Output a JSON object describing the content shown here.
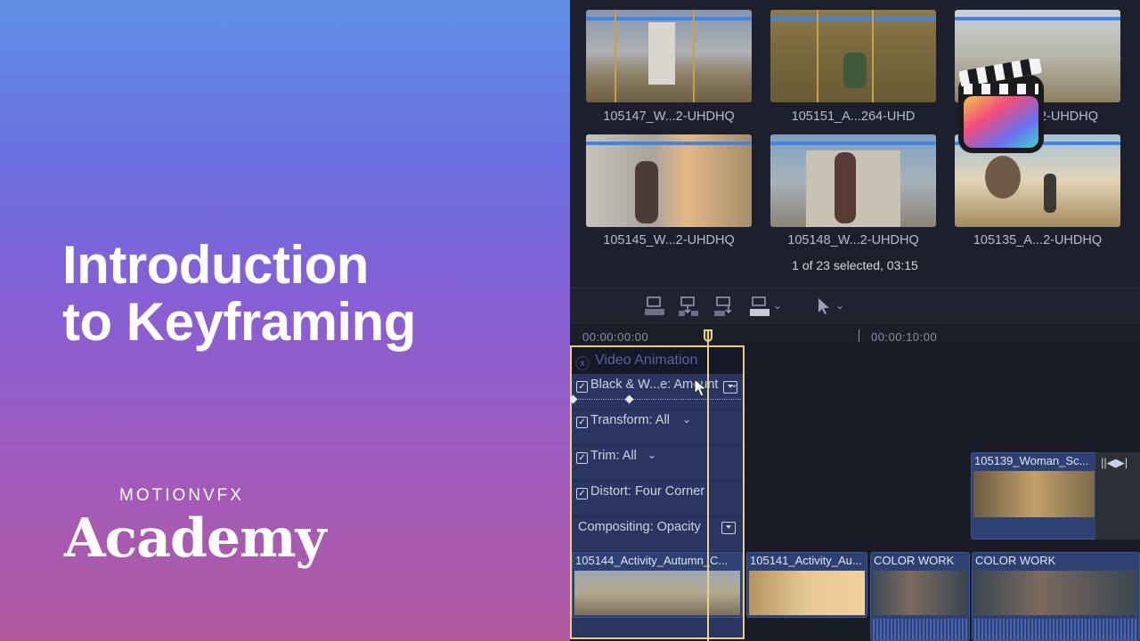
{
  "promo": {
    "title_line1": "Introduction",
    "title_line2": "to Keyframing",
    "brand_top": "MOTIONVFX",
    "brand_main": "Academy"
  },
  "browser": {
    "clips": [
      {
        "label": "105147_W...2-UHDHQ"
      },
      {
        "label": "105151_A...264-UHD"
      },
      {
        "label": "2-UHDHQ"
      },
      {
        "label": "105145_W...2-UHDHQ"
      },
      {
        "label": "105148_W...2-UHDHQ"
      },
      {
        "label": "105135_A...2-UHDHQ"
      }
    ],
    "status": "1 of 23 selected, 03:15"
  },
  "ruler": {
    "tc_start": "00:00:00:00",
    "tc_mid": "00:00:10:00"
  },
  "video_animation": {
    "title": "Video Animation",
    "params": [
      {
        "label": "Black & W...e: Amount"
      },
      {
        "label": "Transform: All"
      },
      {
        "label": "Trim: All"
      },
      {
        "label": "Distort: Four Corner"
      },
      {
        "label": "Compositing: Opacity"
      }
    ]
  },
  "timeline": {
    "connected_clip": "105139_Woman_Sc...",
    "clips": [
      {
        "label": "105144_Activity_Autumn_C..."
      },
      {
        "label": "105141_Activity_Au..."
      },
      {
        "label": "COLOR WORK"
      },
      {
        "label": "COLOR WORK"
      }
    ]
  },
  "colors": {
    "accent_blue": "#3f84e6",
    "playhead": "#e7d28e",
    "clip_blue": "#2d4172"
  }
}
